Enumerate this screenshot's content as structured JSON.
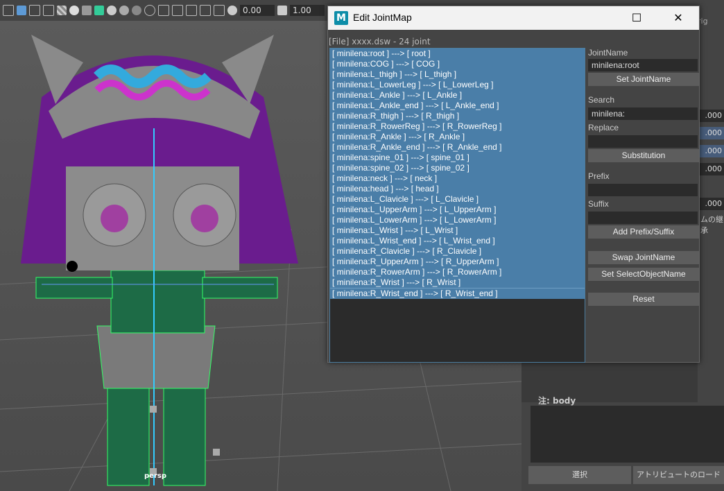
{
  "toolbar": {
    "field1": "0.00",
    "field2": "1.00"
  },
  "viewport": {
    "camera_label": "persp"
  },
  "right_panel": {
    "tab_label": "rig",
    "fields": [
      ".000",
      ".000",
      ".000",
      ".000",
      ".000"
    ],
    "side_text": "ムの継承",
    "note_label": "注:  body",
    "select_button": "選択",
    "attribute_button": "アトリビュートのロード"
  },
  "dialog": {
    "title": "Edit JointMap",
    "app_icon_letter": "M",
    "file_label": "[File] xxxx.dsw - 24 joint",
    "joints": [
      "[ minilena:root ] ---> [ root ]",
      "[ minilena:COG ] ---> [ COG ]",
      "[ minilena:L_thigh ] ---> [ L_thigh ]",
      "[ minilena:L_LowerLeg ] ---> [ L_LowerLeg ]",
      "[ minilena:L_Ankle ] ---> [ L_Ankle ]",
      "[ minilena:L_Ankle_end ] ---> [ L_Ankle_end ]",
      "[ minilena:R_thigh ] ---> [ R_thigh ]",
      "[ minilena:R_RowerReg ] ---> [ R_RowerReg ]",
      "[ minilena:R_Ankle ] ---> [ R_Ankle ]",
      "[ minilena:R_Ankle_end ] ---> [ R_Ankle_end ]",
      "[ minilena:spine_01 ] ---> [ spine_01 ]",
      "[ minilena:spine_02 ] ---> [ spine_02 ]",
      "[ minilena:neck ] ---> [ neck ]",
      "[ minilena:head ] ---> [ head ]",
      "[ minilena:L_Clavicle ] ---> [ L_Clavicle ]",
      "[ minilena:L_UpperArm ] ---> [ L_UpperArm ]",
      "[ minilena:L_LowerArm ] ---> [ L_LowerArm ]",
      "[ minilena:L_Wrist ] ---> [ L_Wrist ]",
      "[ minilena:L_Wrist_end ] ---> [ L_Wrist_end ]",
      "[ minilena:R_Clavicle ] ---> [ R_Clavicle ]",
      "[ minilena:R_UpperArm ] ---> [ R_UpperArm ]",
      "[ minilena:R_RowerArm ] ---> [ R_RowerArm ]",
      "[ minilena:R_Wrist ] ---> [ R_Wrist ]",
      "[ minilena:R_Wrist_end ] ---> [ R_Wrist_end ]"
    ],
    "joint_name_label": "JointName",
    "joint_name_value": "minilena:root",
    "set_joint_name_button": "Set JointName",
    "search_label": "Search",
    "search_value": "minilena:",
    "replace_label": "Replace",
    "replace_value": "",
    "substitution_button": "Substitution",
    "prefix_label": "Prefix",
    "prefix_value": "",
    "suffix_label": "Suffix",
    "suffix_value": "",
    "add_prefix_suffix_button": "Add Prefix/Suffix",
    "swap_joint_name_button": "Swap JointName",
    "set_select_object_name_button": "Set SelectObjectName",
    "reset_button": "Reset"
  },
  "colors": {
    "list_selection": "#4a7ea8",
    "dialog_bg": "#444444",
    "accent_teal": "#0d8da8"
  }
}
